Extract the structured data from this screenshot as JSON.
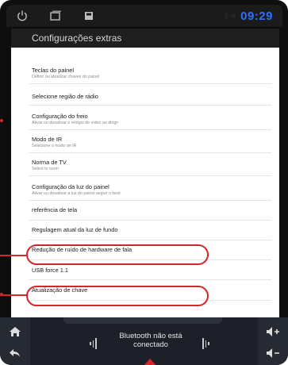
{
  "status": {
    "time": "09:29"
  },
  "header": {
    "title": "Configurações extras"
  },
  "settings": [
    {
      "title": "Teclas do painel",
      "subtitle": "Definir ou atualizar chaves do painel"
    },
    {
      "title": "Selecione região de rádio",
      "subtitle": ""
    },
    {
      "title": "Configuração do freio",
      "subtitle": "Ativar ou desativar o relógio de vídeo ao dirigir"
    },
    {
      "title": "Modo de IR",
      "subtitle": "Selecione o modo de IR"
    },
    {
      "title": "Norma de TV",
      "subtitle": "Select tv norm"
    },
    {
      "title": "Configuração da luz do painel",
      "subtitle": "Ativar ou desativar a luz do painel seguir o farol"
    },
    {
      "title": "referência de tela",
      "subtitle": ""
    },
    {
      "title": "Regulagem atual da luz de fundo",
      "subtitle": ""
    },
    {
      "title": "Redução de ruído de hardware de fala",
      "subtitle": ""
    },
    {
      "title": "USB force 1.1",
      "subtitle": ""
    },
    {
      "title": "Atualização de chave",
      "subtitle": ""
    }
  ],
  "bottom": {
    "bluetooth_status": "Bluetooth não está conectado"
  },
  "colors": {
    "accent": "#d8232a",
    "time": "#2e6fff"
  },
  "icons": [
    "power-icon",
    "recent-apps-icon",
    "screenshot-icon",
    "bluetooth-icon",
    "home-icon",
    "back-icon",
    "volume-up-icon",
    "volume-down-icon"
  ]
}
